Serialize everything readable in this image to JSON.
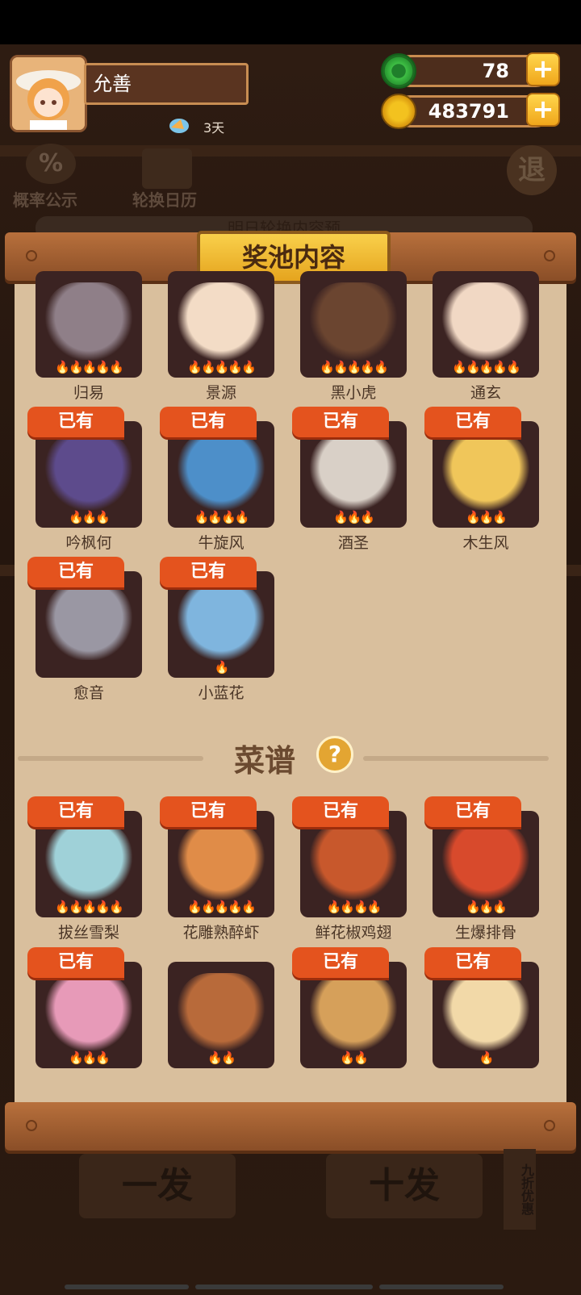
{
  "player": {
    "name": "允善",
    "days": "3天"
  },
  "currency": {
    "jade": "78",
    "coins": "483791",
    "plus_label": "+"
  },
  "side_buttons": {
    "probability": "概率公示",
    "calendar": "轮换日历",
    "probability_icon": "%",
    "exit_icon": "退"
  },
  "panel": {
    "title": "奖池内容",
    "partial_text": "明日轮换内容预"
  },
  "badge": "已有",
  "characters": [
    {
      "name": "归易",
      "flames": 5,
      "owned": false,
      "color": "#8f7f88"
    },
    {
      "name": "景源",
      "flames": 5,
      "owned": false,
      "color": "#f3dcc6"
    },
    {
      "name": "黑小虎",
      "flames": 5,
      "owned": false,
      "color": "#6b4530"
    },
    {
      "name": "通玄",
      "flames": 5,
      "owned": false,
      "color": "#f1d8c4"
    },
    {
      "name": "吟枫何",
      "flames": 3,
      "owned": true,
      "color": "#5d4b8c"
    },
    {
      "name": "牛旋风",
      "flames": 4,
      "owned": true,
      "color": "#4d8fc9"
    },
    {
      "name": "酒圣",
      "flames": 3,
      "owned": true,
      "color": "#d9d0c7"
    },
    {
      "name": "木生风",
      "flames": 3,
      "owned": true,
      "color": "#f0c65a"
    },
    {
      "name": "愈音",
      "flames": 0,
      "owned": true,
      "color": "#9a97a3"
    },
    {
      "name": "小蓝花",
      "flames": 1,
      "owned": true,
      "color": "#7fb5de"
    }
  ],
  "recipes_title": "菜谱",
  "help_icon": "?",
  "recipes": [
    {
      "name": "拔丝雪梨",
      "flames": 5,
      "owned": true,
      "color": "#9fd1d8"
    },
    {
      "name": "花雕熟醉虾",
      "flames": 5,
      "owned": true,
      "color": "#e08c48"
    },
    {
      "name": "鲜花椒鸡翅",
      "flames": 4,
      "owned": true,
      "color": "#c8582c"
    },
    {
      "name": "生爆排骨",
      "flames": 3,
      "owned": true,
      "color": "#d84a2c"
    },
    {
      "name": "",
      "flames": 3,
      "owned": true,
      "color": "#e79ab8"
    },
    {
      "name": "",
      "flames": 2,
      "owned": false,
      "color": "#b86a3a"
    },
    {
      "name": "",
      "flames": 2,
      "owned": true,
      "color": "#d6a05a"
    },
    {
      "name": "",
      "flames": 1,
      "owned": true,
      "color": "#f2d9a8"
    }
  ],
  "bottom": {
    "single": "一发",
    "ten": "十发",
    "discount": "九折优惠"
  }
}
